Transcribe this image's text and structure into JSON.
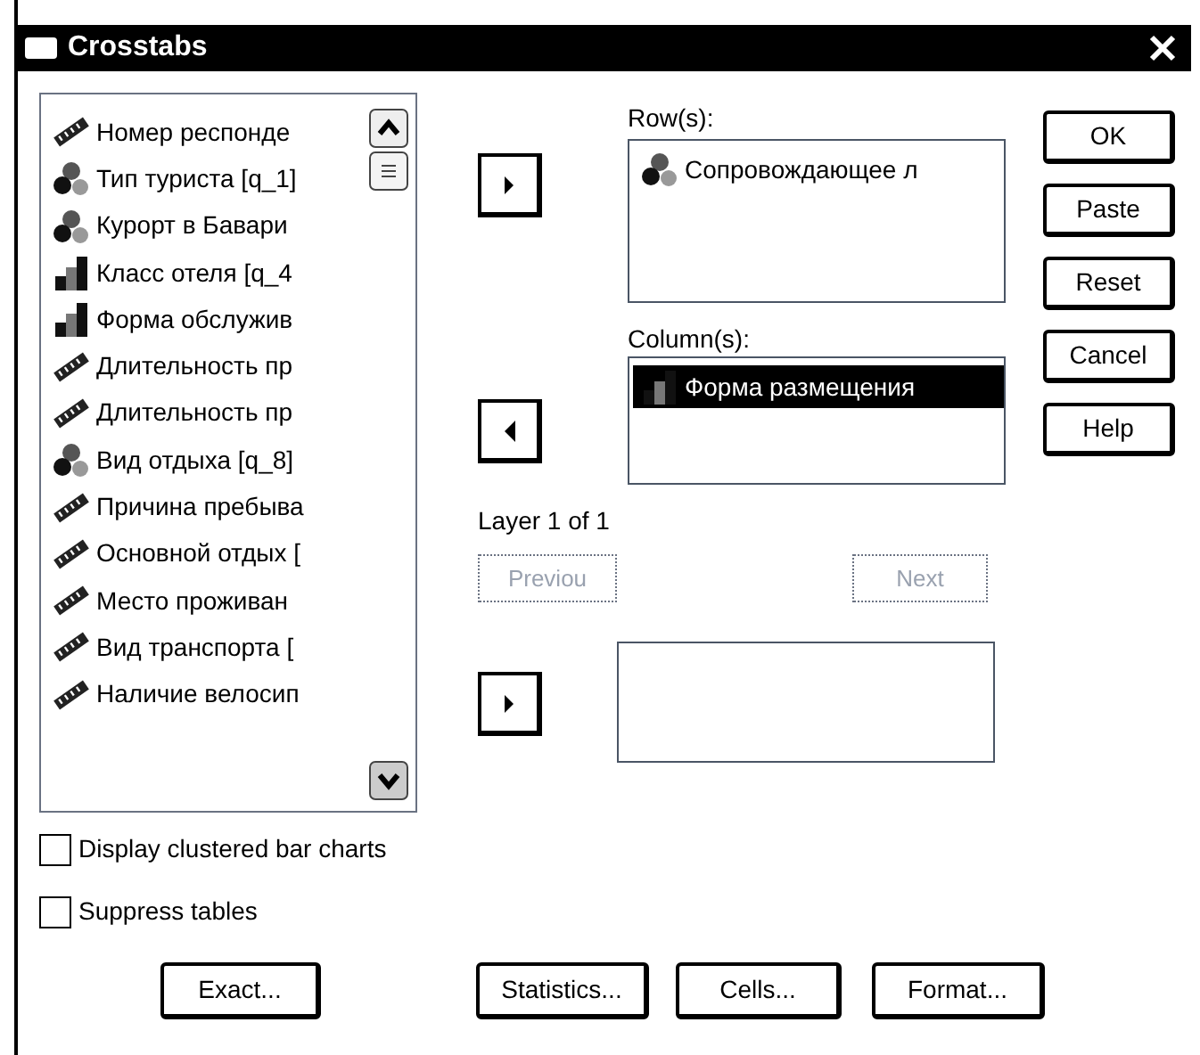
{
  "window": {
    "title": "Crosstabs"
  },
  "variables": [
    {
      "label": "Номер респонде",
      "kind": "scale",
      "selected": false
    },
    {
      "label": "Тип туриста [q_1]",
      "kind": "nominal",
      "selected": false
    },
    {
      "label": "Курорт в Бавари",
      "kind": "nominal",
      "selected": false
    },
    {
      "label": "Класс отеля [q_4",
      "kind": "ordinal",
      "selected": false
    },
    {
      "label": "Форма обслужив",
      "kind": "ordinal",
      "selected": false
    },
    {
      "label": "Длительность пр",
      "kind": "scale",
      "selected": false
    },
    {
      "label": "Длительность пр",
      "kind": "scale",
      "selected": false
    },
    {
      "label": "Вид отдыха [q_8]",
      "kind": "nominal",
      "selected": false
    },
    {
      "label": "Причина пребыва",
      "kind": "scale",
      "selected": false
    },
    {
      "label": "Основной отдых [",
      "kind": "scale",
      "selected": false
    },
    {
      "label": "Место проживан",
      "kind": "scale",
      "selected": false
    },
    {
      "label": "Вид транспорта [",
      "kind": "scale",
      "selected": false
    },
    {
      "label": "Наличие велосип",
      "kind": "scale",
      "selected": false
    }
  ],
  "rows_label": "Row(s):",
  "rows": [
    {
      "label": "Сопровождающее л",
      "kind": "nominal",
      "selected": false
    }
  ],
  "columns_label": "Column(s):",
  "columns": [
    {
      "label": "Форма размещения",
      "kind": "ordinal",
      "selected": true
    }
  ],
  "layer": {
    "label": "Layer 1 of 1",
    "previous": {
      "label": "Previou",
      "disabled": true
    },
    "next": {
      "label": "Next",
      "disabled": true
    }
  },
  "checkboxes": [
    {
      "label": "Display clustered bar charts",
      "checked": false
    },
    {
      "label": "Suppress tables",
      "checked": false
    }
  ],
  "side_buttons": [
    "OK",
    "Paste",
    "Reset",
    "Cancel",
    "Help"
  ],
  "bottom_buttons": [
    "Exact...",
    "Statistics...",
    "Cells...",
    "Format..."
  ]
}
